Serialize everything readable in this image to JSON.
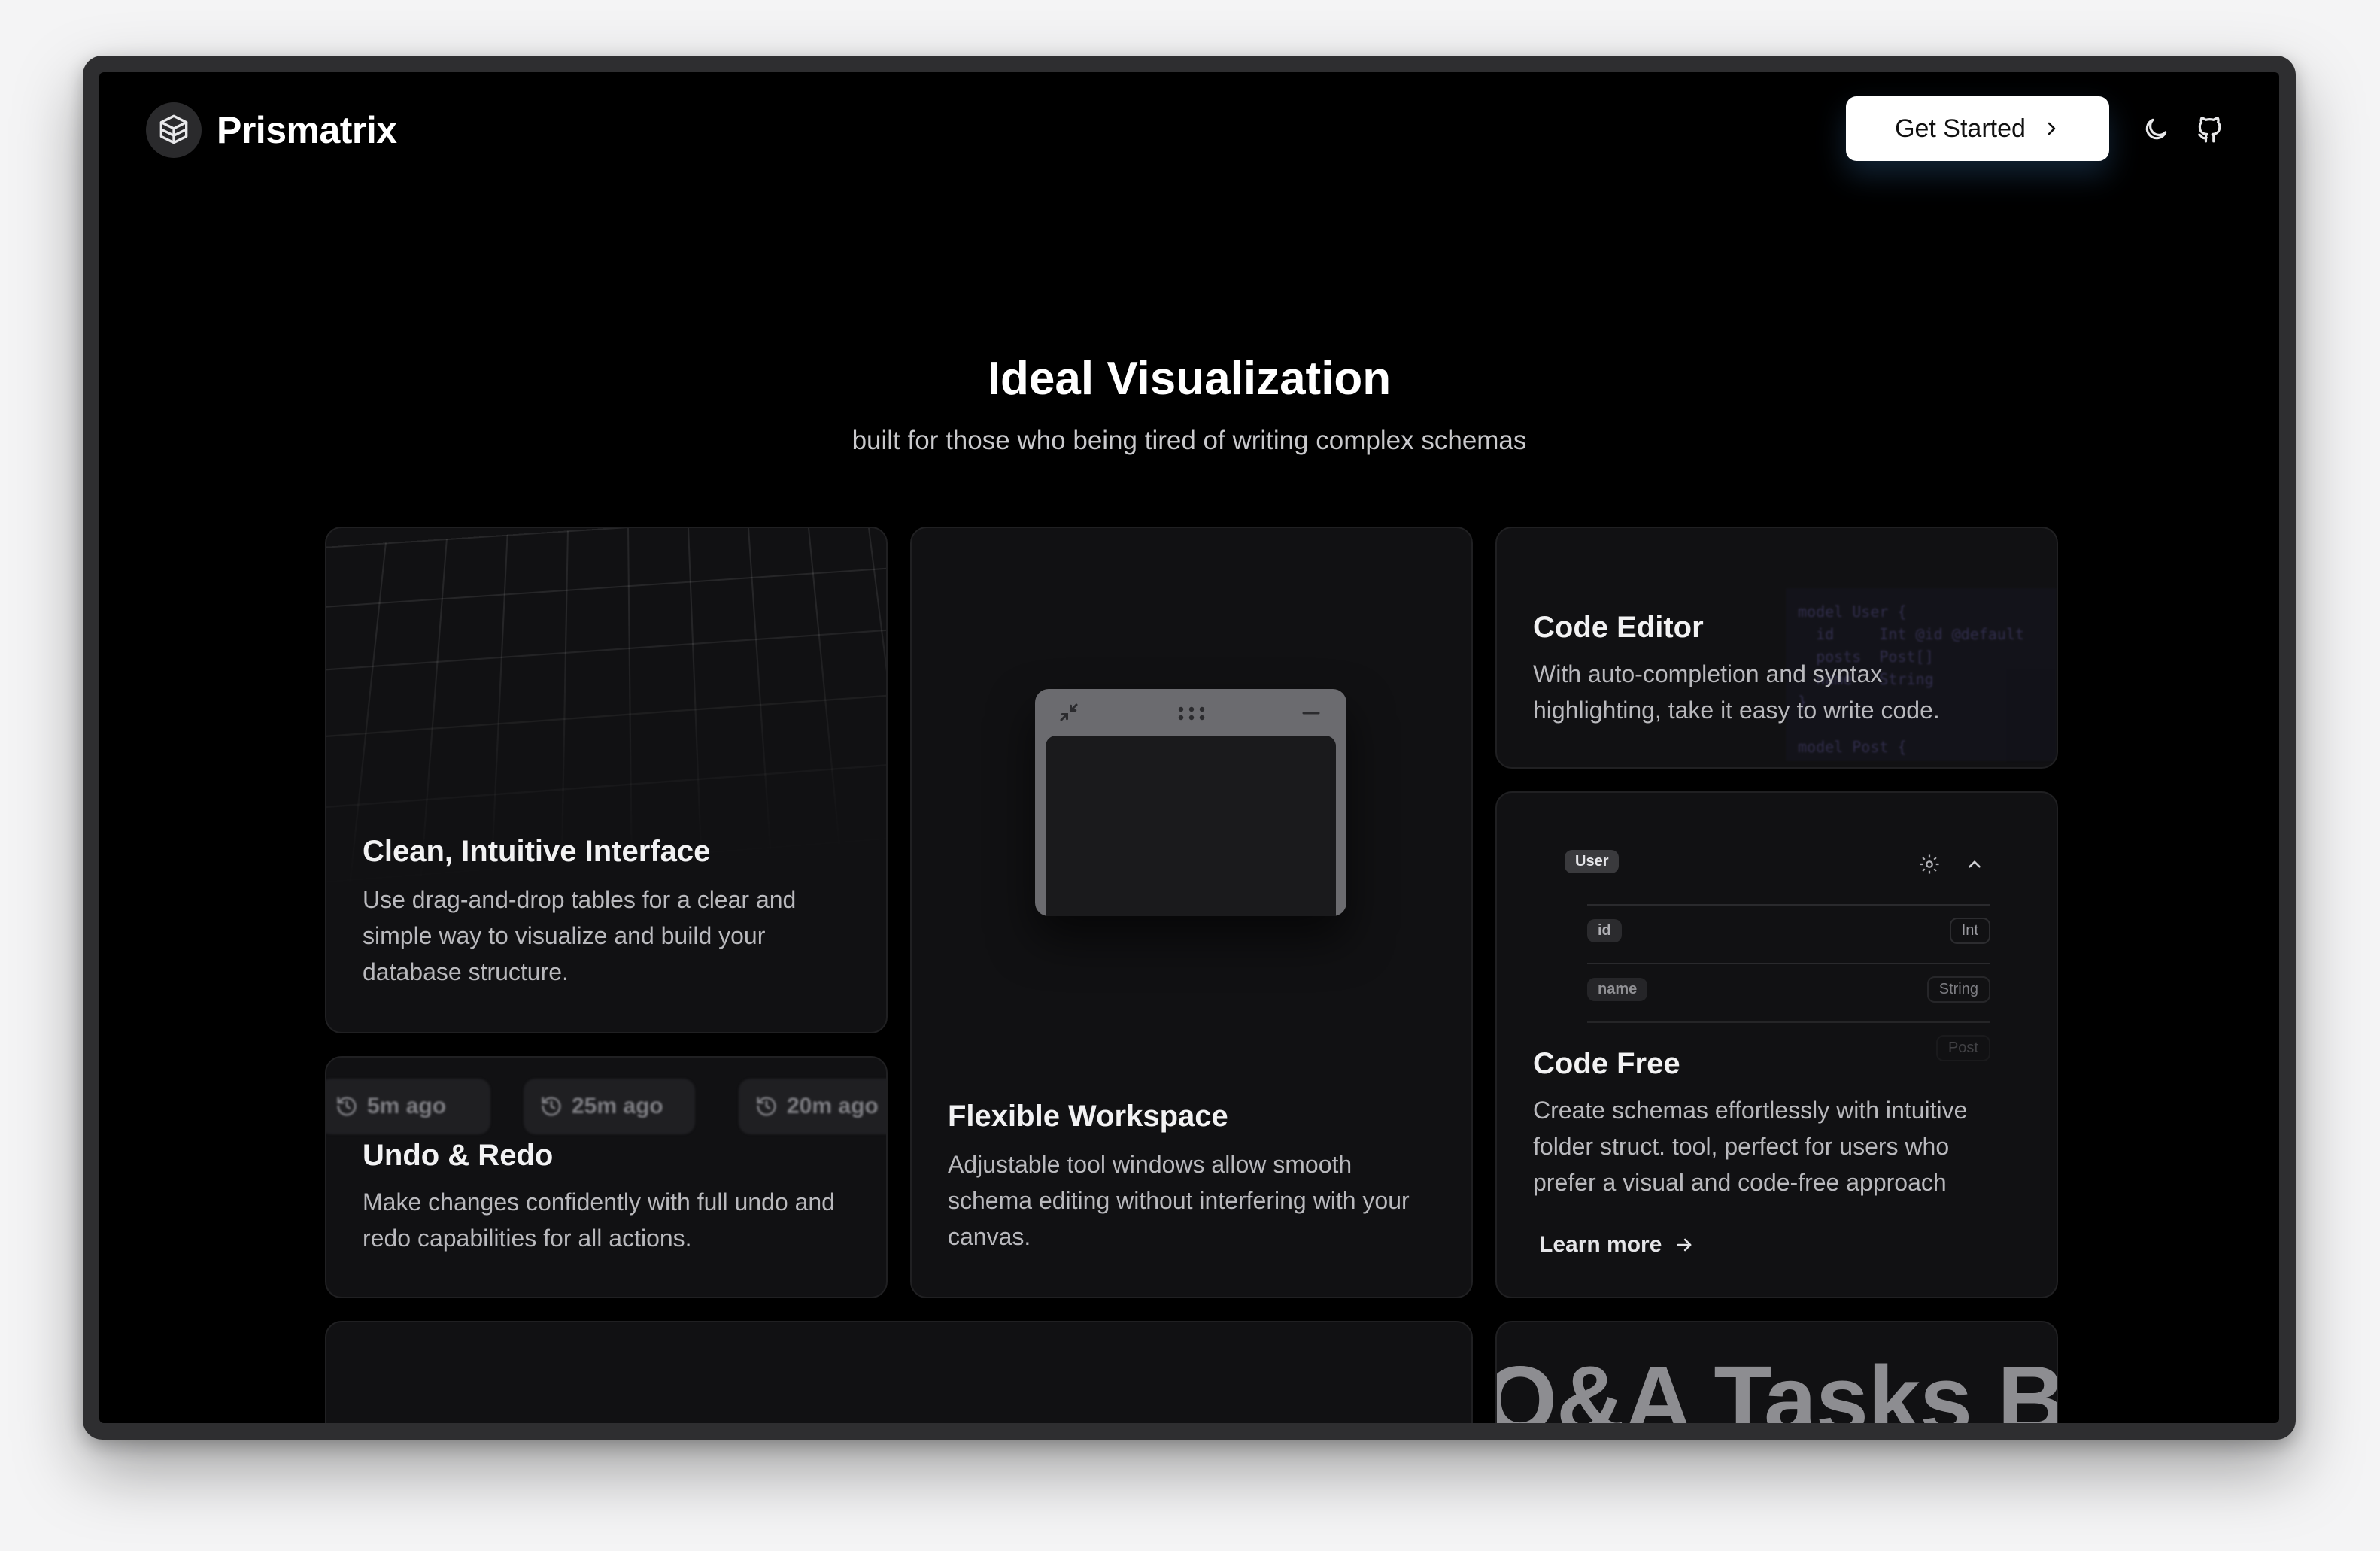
{
  "brand": {
    "name": "Prismatrix"
  },
  "header": {
    "cta_label": "Get Started"
  },
  "hero": {
    "title": "Ideal Visualization",
    "subtitle": "built for those who being tired of writing complex schemas"
  },
  "cards": {
    "interface": {
      "title": "Clean, Intuitive Interface",
      "desc": "Use drag-and-drop tables for a clear and simple way to visualize and build your database structure."
    },
    "workspace": {
      "title": "Flexible Workspace",
      "desc": "Adjustable tool windows allow smooth schema editing without interfering with your canvas."
    },
    "editor": {
      "title": "Code Editor",
      "desc": "With auto-completion and syntax highlighting, take it easy to write code."
    },
    "undo": {
      "title": "Undo & Redo",
      "desc": "Make changes confidently with full undo and redo capabilities for all actions.",
      "history": [
        "5m ago",
        "25m ago",
        "20m ago"
      ]
    },
    "codefree": {
      "title": "Code Free",
      "desc": "Create schemas effortlessly with intuitive folder struct. tool, perfect for users who prefer a visual and code-free approach",
      "learn_more": "Learn more",
      "table_name": "User",
      "fields": [
        {
          "name": "id",
          "type": "Int"
        },
        {
          "name": "name",
          "type": "String"
        },
        {
          "name": "",
          "type": "Post"
        }
      ]
    },
    "marquee": {
      "text": "Q&A Tasks Blo"
    }
  }
}
